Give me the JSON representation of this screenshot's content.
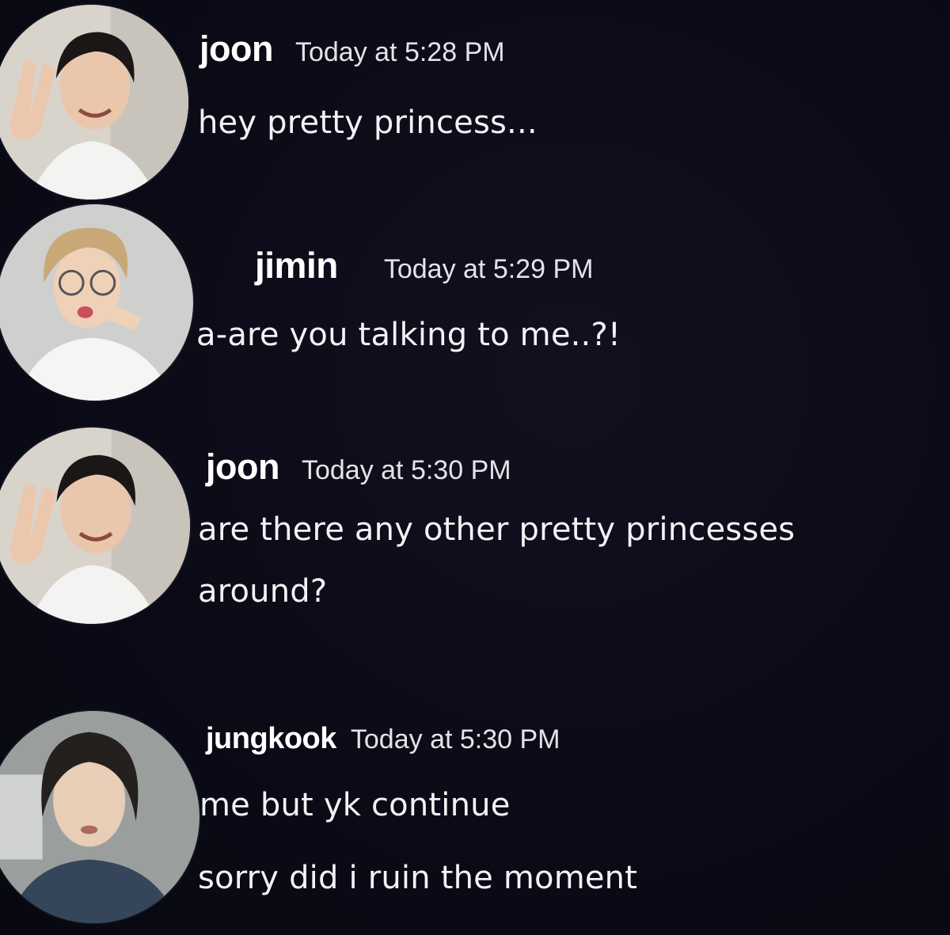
{
  "messages": [
    {
      "author": "joon",
      "timestamp": "Today at 5:28 PM",
      "avatar": "joon-avatar-peace-sign",
      "lines": [
        "hey pretty princess..."
      ]
    },
    {
      "author": "jimin",
      "timestamp": "Today at 5:29 PM",
      "avatar": "jimin-avatar-glasses-pout",
      "lines": [
        "a-are you talking to me..?!"
      ]
    },
    {
      "author": "joon",
      "timestamp": "Today at 5:30 PM",
      "avatar": "joon-avatar-peace-sign",
      "lines": [
        "are there any other pretty princesses",
        "around?"
      ]
    },
    {
      "author": "jungkook",
      "timestamp": "Today at 5:30 PM",
      "avatar": "jungkook-avatar-selfie",
      "lines": [
        "me but yk continue",
        "sorry did i ruin the moment"
      ]
    }
  ],
  "colors": {
    "background": "#0c0c19",
    "username": "#ffffff",
    "timestamp": "#e3e3e8",
    "message_text": "#f2f2f5"
  }
}
